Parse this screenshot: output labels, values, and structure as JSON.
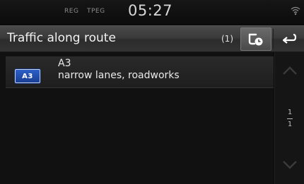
{
  "status": {
    "reg": "REG",
    "tpeg": "TPEG",
    "time": "05:27"
  },
  "header": {
    "title": "Traffic along route",
    "count": "(1)"
  },
  "items": [
    {
      "badge": "A3",
      "road": "A3",
      "description": "narrow lanes, roadworks"
    }
  ],
  "pagination": {
    "current": "1",
    "total": "1"
  },
  "icons": {
    "status_right": "wifi-icon",
    "route_button": "route-traffic-icon",
    "back_button": "back-arrow-icon",
    "scroll_up": "chevron-up-icon",
    "scroll_down": "chevron-down-icon"
  },
  "colors": {
    "badge_blue": "#2d5fc6",
    "header_gray": "#3a3a3a",
    "background": "#0a0a0a"
  }
}
